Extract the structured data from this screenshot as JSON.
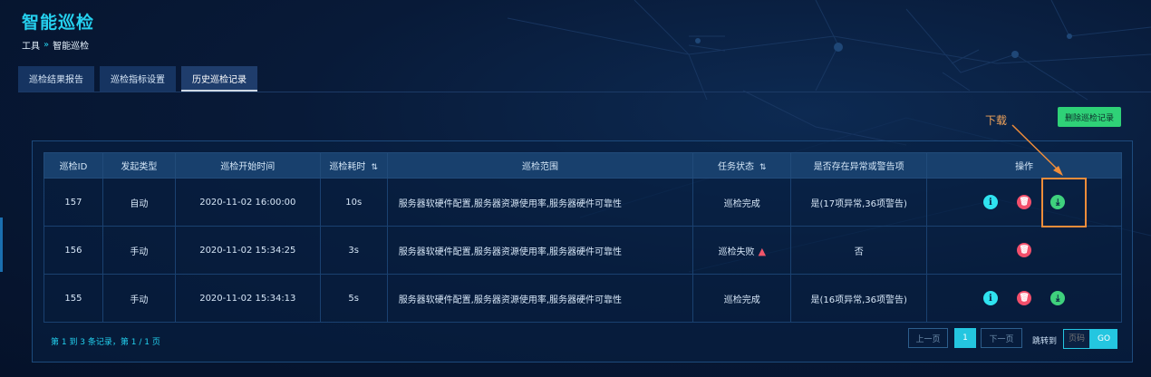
{
  "page": {
    "title": "智能巡检",
    "breadcrumb": [
      "工具",
      "智能巡检"
    ],
    "breadcrumb_sep": "»"
  },
  "tabs": [
    {
      "label": "巡检结果报告",
      "active": false
    },
    {
      "label": "巡检指标设置",
      "active": false
    },
    {
      "label": "历史巡检记录",
      "active": true
    }
  ],
  "toolbar": {
    "delete_records_label": "删除巡检记录",
    "download_annotation": "下载"
  },
  "table": {
    "columns": [
      "巡检ID",
      "发起类型",
      "巡检开始时间",
      "巡检耗时",
      "巡检范围",
      "任务状态",
      "是否存在异常或警告项",
      "操作"
    ],
    "rows": [
      {
        "id": "157",
        "type": "自动",
        "start": "2020-11-02 16:00:00",
        "duration": "10s",
        "scope": "服务器软硬件配置,服务器资源使用率,服务器硬件可靠性",
        "status": "巡检完成",
        "status_failed": false,
        "anomaly": "是(17项异常,36项警告)",
        "actions": [
          "info",
          "delete",
          "download"
        ]
      },
      {
        "id": "156",
        "type": "手动",
        "start": "2020-11-02 15:34:25",
        "duration": "3s",
        "scope": "服务器软硬件配置,服务器资源使用率,服务器硬件可靠性",
        "status": "巡检失败",
        "status_failed": true,
        "anomaly": "否",
        "actions": [
          "delete"
        ]
      },
      {
        "id": "155",
        "type": "手动",
        "start": "2020-11-02 15:34:13",
        "duration": "5s",
        "scope": "服务器软硬件配置,服务器资源使用率,服务器硬件可靠性",
        "status": "巡检完成",
        "status_failed": false,
        "anomaly": "是(16项异常,36项警告)",
        "actions": [
          "info",
          "delete",
          "download"
        ]
      }
    ]
  },
  "pagination": {
    "summary": "第 1 到 3 条记录，第 1 / 1 页",
    "prev_label": "上一页",
    "current_page": "1",
    "next_label": "下一页",
    "jump_label": "跳转到",
    "page_placeholder": "页码",
    "go_label": "GO"
  },
  "icons": {
    "info": "info-icon",
    "delete": "trash-icon",
    "download": "download-icon",
    "warning": "warning-triangle-icon",
    "sort": "sort-icon"
  },
  "colors": {
    "accent": "#25d0ee",
    "success": "#3fd17d",
    "danger": "#f24f6b",
    "annotation": "#f08d3a"
  }
}
